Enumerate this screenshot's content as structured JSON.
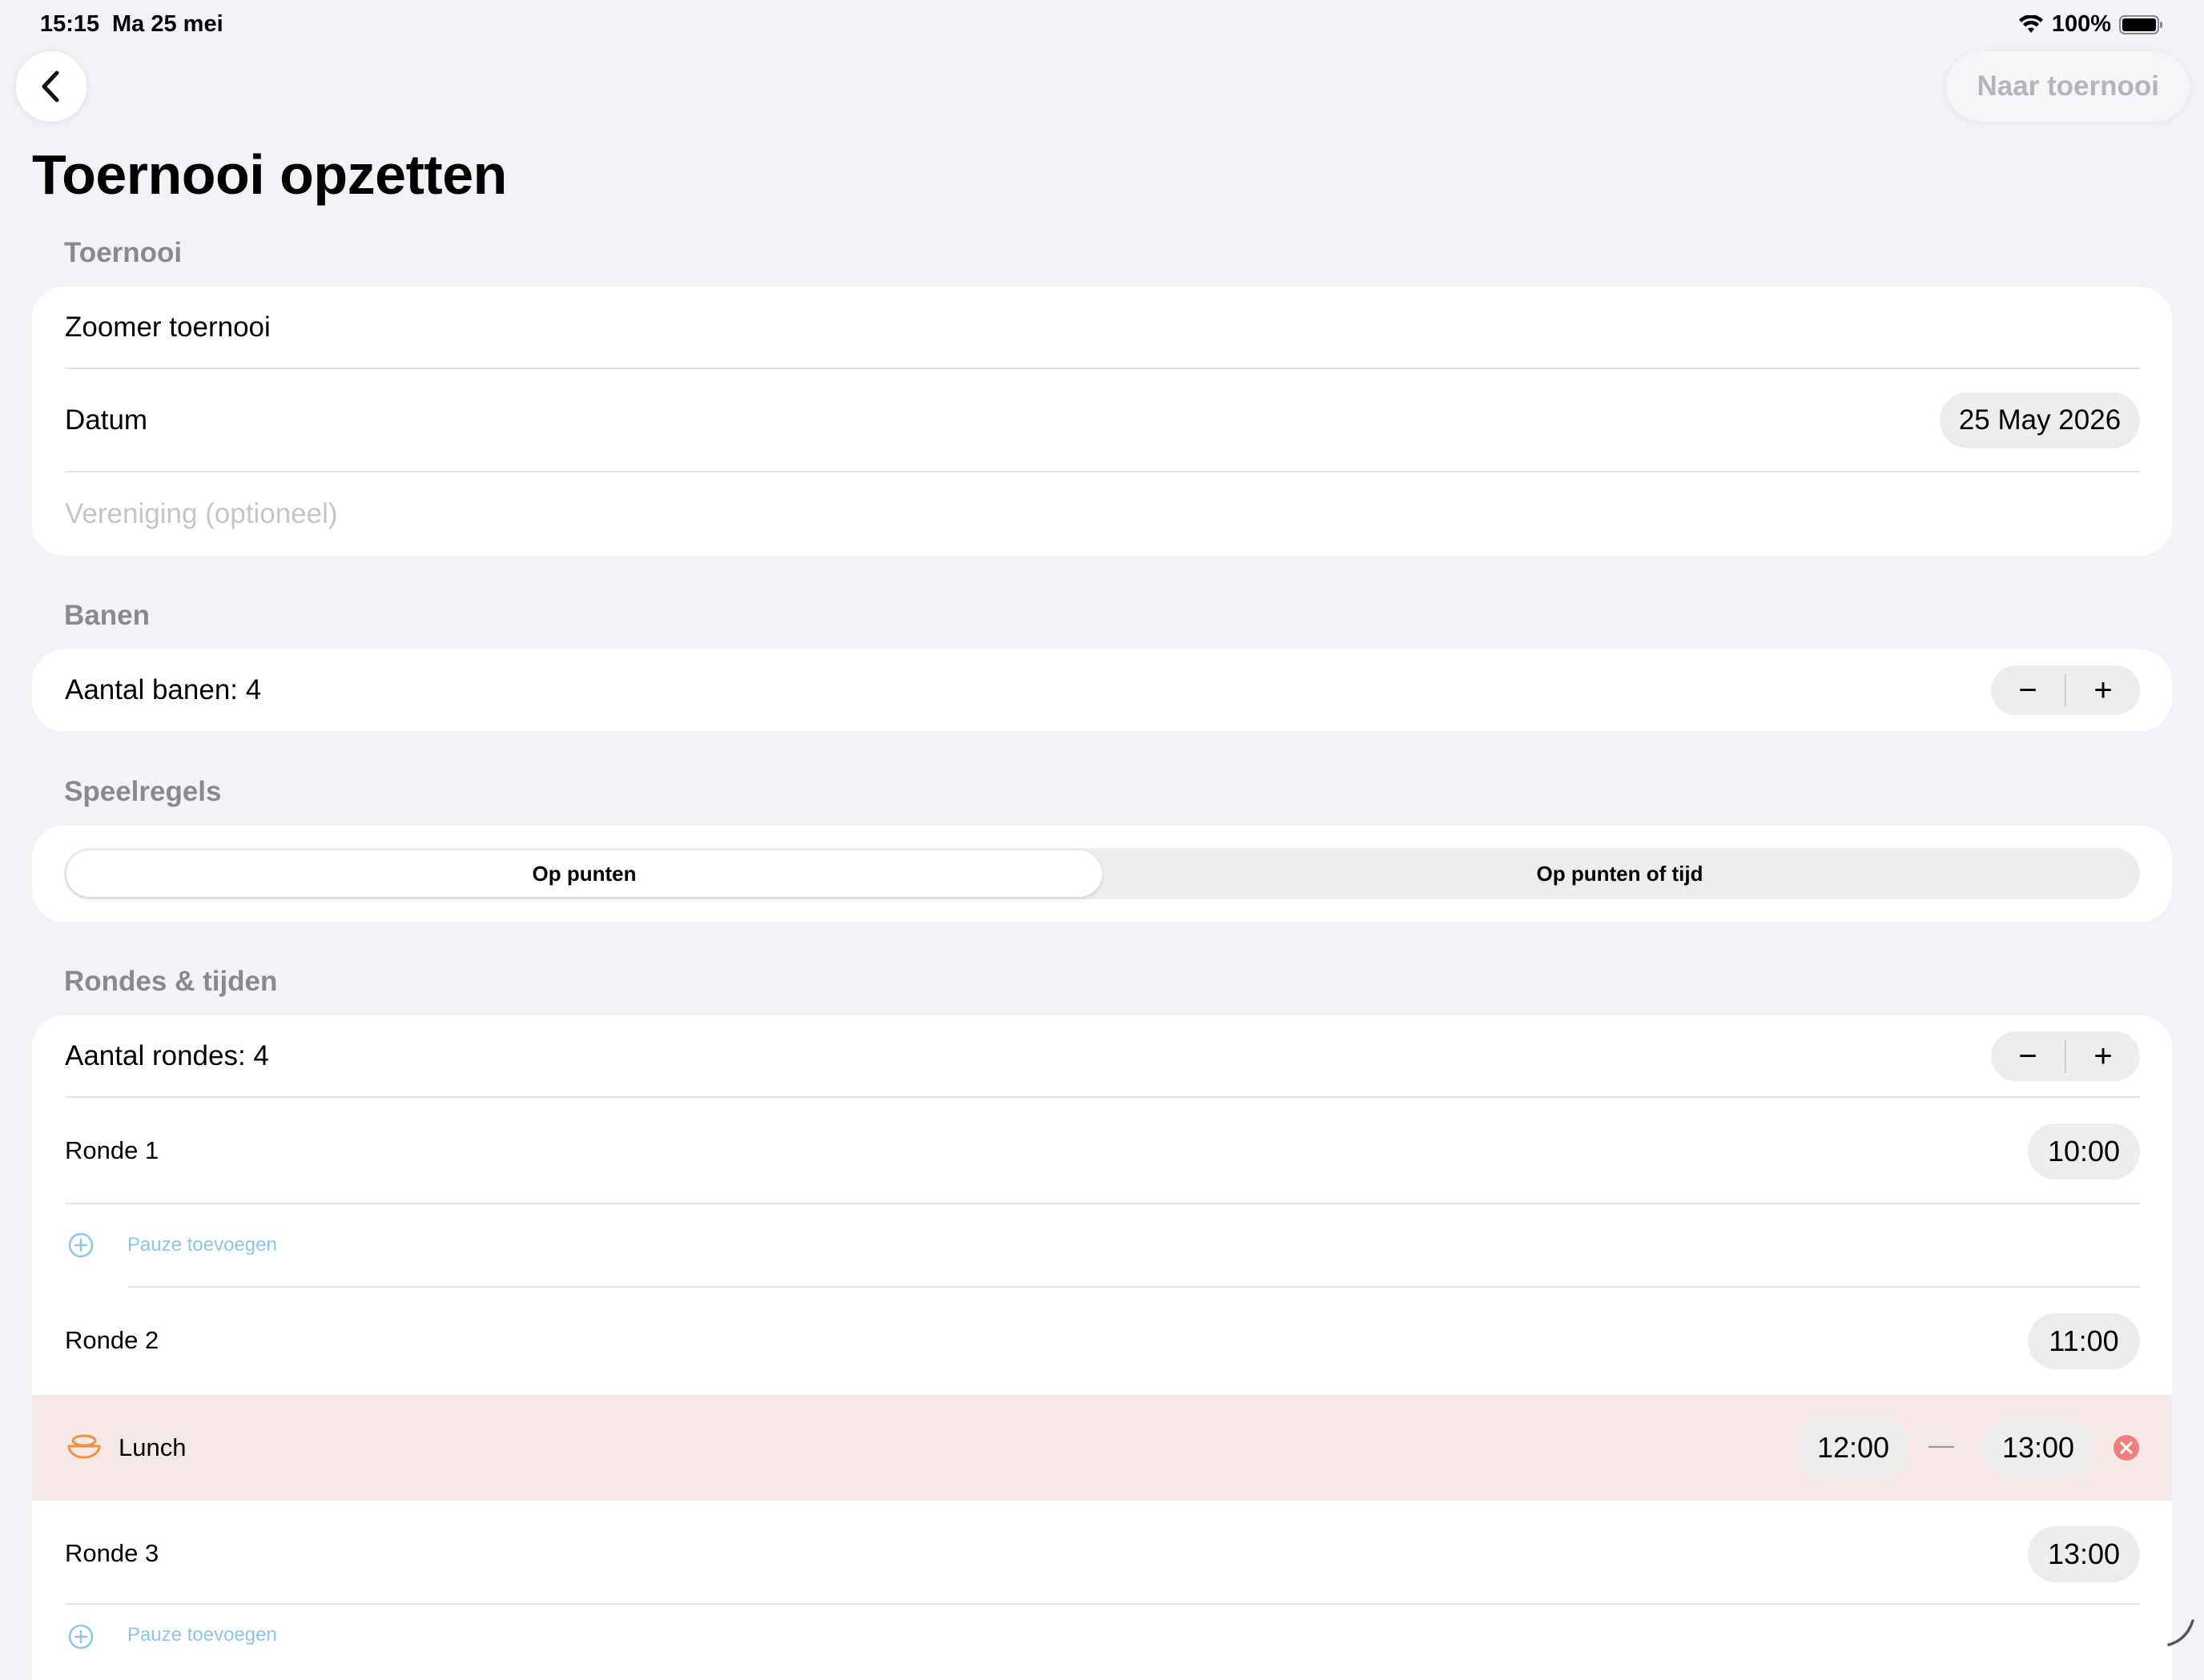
{
  "status_bar": {
    "time": "15:15",
    "date": "Ma 25 mei",
    "battery": "100%"
  },
  "nav": {
    "action_label": "Naar toernooi"
  },
  "page_title": "Toernooi opzetten",
  "sections": {
    "toernooi": {
      "header": "Toernooi",
      "name_value": "Zoomer toernooi",
      "date_label": "Datum",
      "date_value": "25 May 2026",
      "vereniging_placeholder": "Vereniging (optioneel)"
    },
    "banen": {
      "header": "Banen",
      "label": "Aantal banen: 4"
    },
    "speelregels": {
      "header": "Speelregels",
      "options": [
        "Op punten",
        "Op punten of tijd"
      ],
      "selected": "Op punten"
    },
    "rondes": {
      "header": "Rondes & tijden",
      "count_label": "Aantal rondes: 4",
      "add_pause_label": "Pauze toevoegen",
      "rounds": [
        {
          "label": "Ronde 1",
          "time": "10:00"
        },
        {
          "label": "Ronde 2",
          "time": "11:00"
        },
        {
          "label": "Ronde 3",
          "time": "13:00"
        }
      ],
      "lunch": {
        "label": "Lunch",
        "start": "12:00",
        "separator": "—",
        "end": "13:00"
      }
    }
  },
  "stepper": {
    "minus": "−",
    "plus": "+"
  },
  "colors": {
    "background": "#F2F2F7",
    "link": "#8DC4EC",
    "lunch_bg": "#F4E9E7",
    "lunch_icon": "#F0923A",
    "delete": "#F08080"
  },
  "icons": [
    "back-chevron-icon",
    "wifi-icon",
    "battery-icon",
    "plus-circle-icon",
    "lunch-bowl-icon",
    "remove-circle-icon"
  ]
}
